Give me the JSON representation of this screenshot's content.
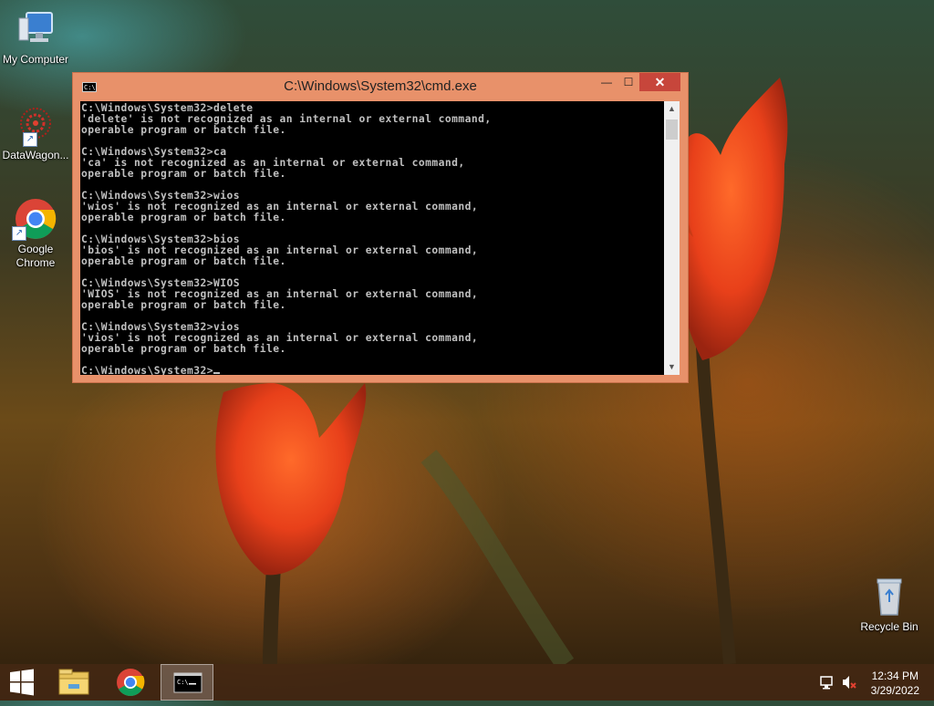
{
  "desktop": {
    "icons": [
      {
        "label": "My Computer"
      },
      {
        "label": "DataWagon..."
      },
      {
        "label": "Google Chrome"
      },
      {
        "label": "Recycle Bin"
      }
    ]
  },
  "window": {
    "title": "C:\\Windows\\System32\\cmd.exe",
    "app_icon_text": "C:\\",
    "minimize_glyph": "—",
    "maximize_glyph": "☐",
    "close_glyph": "✕",
    "console_lines": [
      "C:\\Windows\\System32>delete",
      "'delete' is not recognized as an internal or external command,",
      "operable program or batch file.",
      "",
      "C:\\Windows\\System32>ca",
      "'ca' is not recognized as an internal or external command,",
      "operable program or batch file.",
      "",
      "C:\\Windows\\System32>wios",
      "'wios' is not recognized as an internal or external command,",
      "operable program or batch file.",
      "",
      "C:\\Windows\\System32>bios",
      "'bios' is not recognized as an internal or external command,",
      "operable program or batch file.",
      "",
      "C:\\Windows\\System32>WIOS",
      "'WIOS' is not recognized as an internal or external command,",
      "operable program or batch file.",
      "",
      "C:\\Windows\\System32>vios",
      "'vios' is not recognized as an internal or external command,",
      "operable program or batch file.",
      ""
    ],
    "prompt": "C:\\Windows\\System32>"
  },
  "taskbar": {
    "items": [
      "start-icon",
      "file-explorer-icon",
      "chrome-icon",
      "cmd-icon"
    ],
    "clock": {
      "time": "12:34 PM",
      "date": "3/29/2022"
    },
    "tray_icons": [
      "network-icon",
      "volume-muted-icon"
    ]
  },
  "colors": {
    "window_frame": "#e8916a",
    "close_button": "#c7463b",
    "console_bg": "#000000",
    "console_text": "#c0c0c0"
  }
}
